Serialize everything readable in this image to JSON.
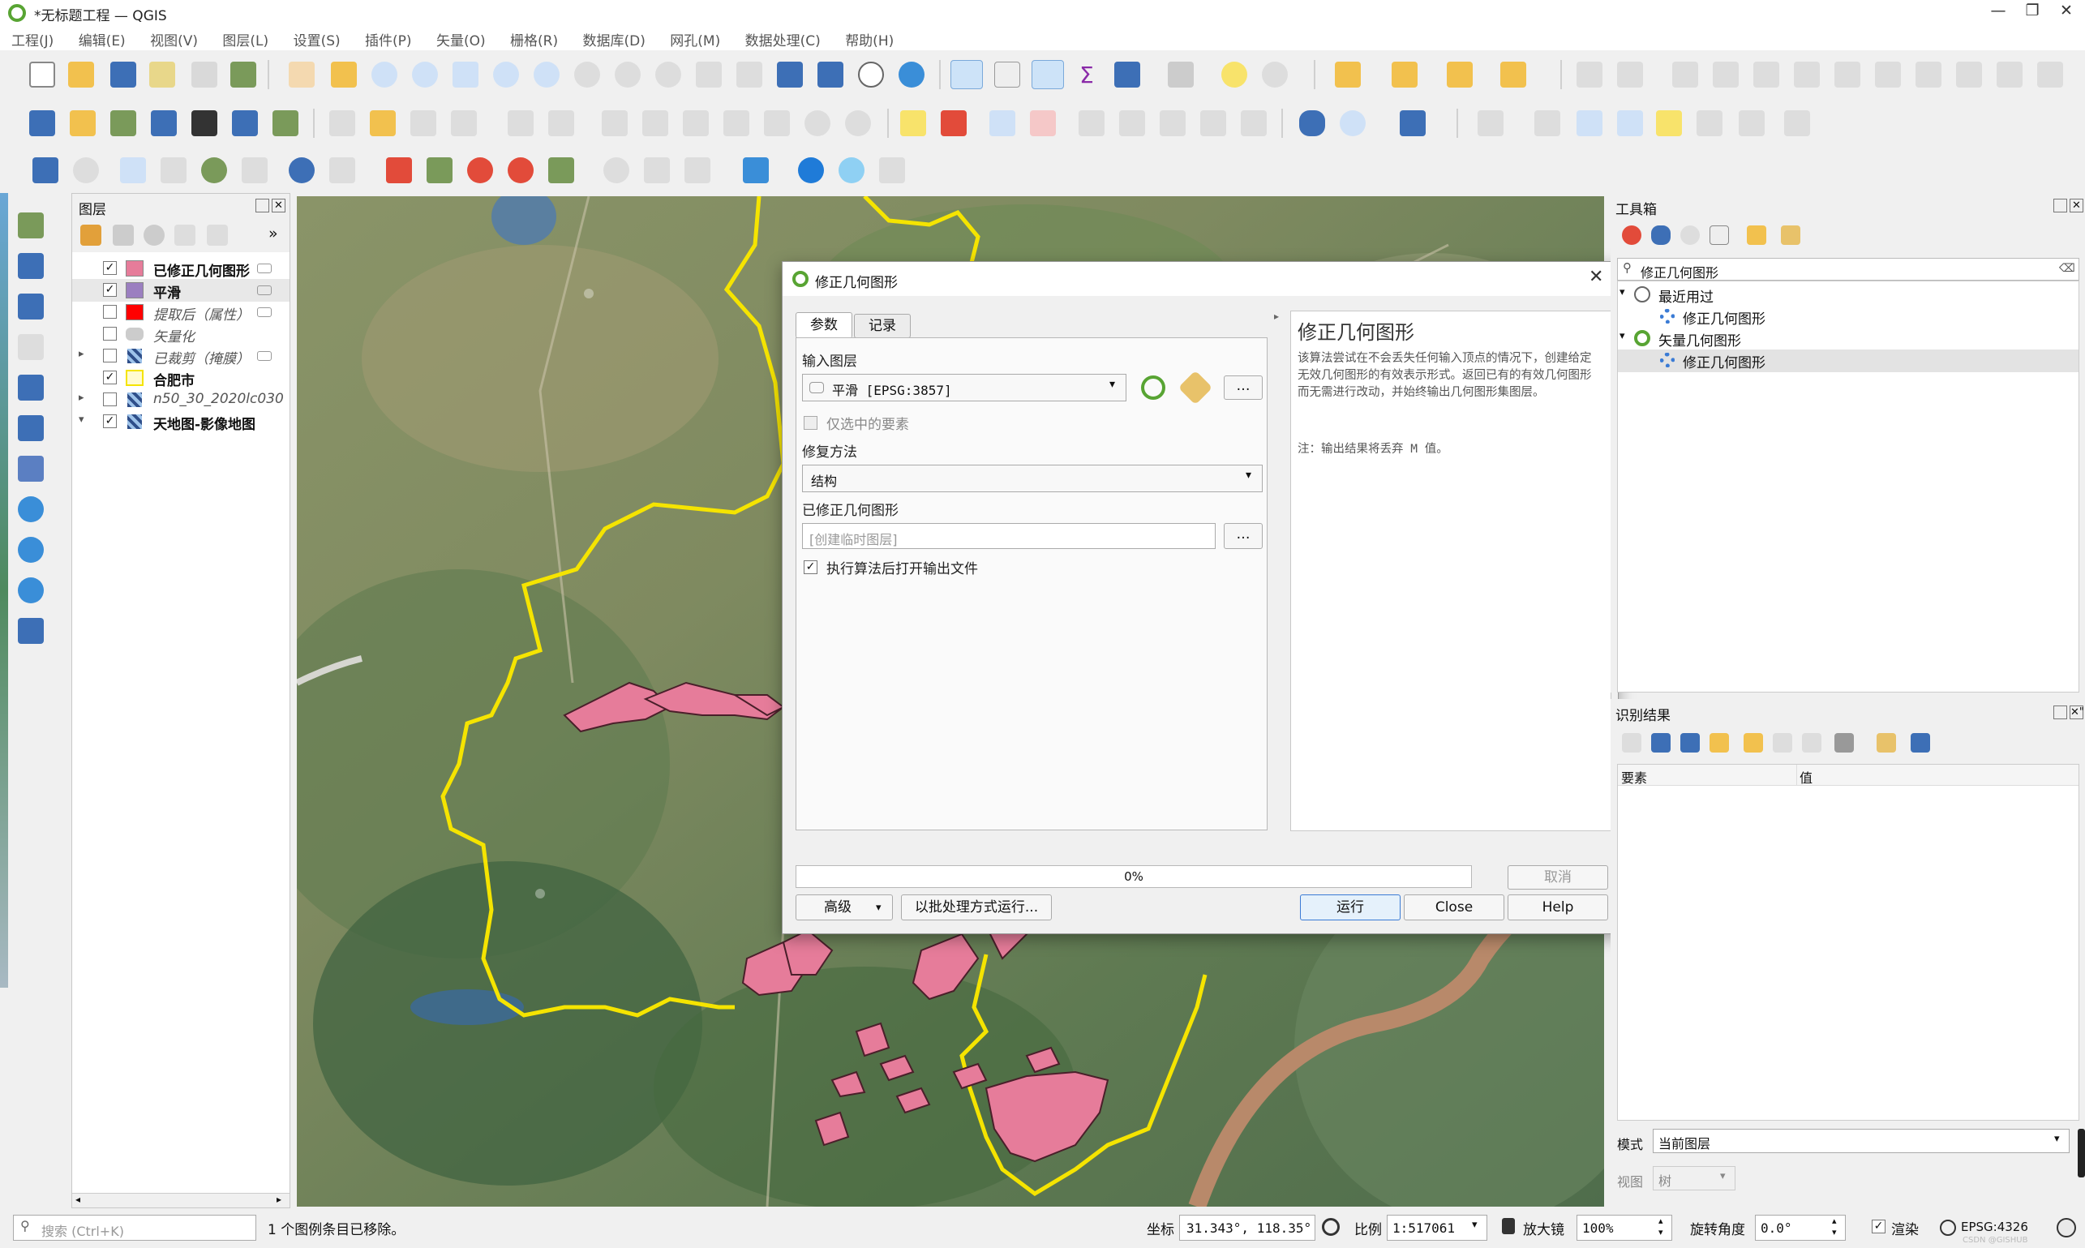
{
  "window": {
    "title": "*无标题工程 — QGIS",
    "minimize": "—",
    "maximize": "❐",
    "close": "✕"
  },
  "menu": [
    "工程(J)",
    "编辑(E)",
    "视图(V)",
    "图层(L)",
    "设置(S)",
    "插件(P)",
    "矢量(O)",
    "栅格(R)",
    "数据库(D)",
    "网孔(M)",
    "数据处理(C)",
    "帮助(H)"
  ],
  "layers_panel": {
    "title": "图层",
    "layers": [
      {
        "name": "已修正几何图形",
        "checked": true,
        "style": "bold",
        "swatch": "#e67c9a"
      },
      {
        "name": "平滑",
        "checked": true,
        "style": "bold",
        "swatch": "#9b7fc0"
      },
      {
        "name": "提取后（属性）",
        "checked": false,
        "style": "italic",
        "swatch": "#ff0000"
      },
      {
        "name": "矢量化",
        "checked": false,
        "style": "italic",
        "swatch": ""
      },
      {
        "name": "已裁剪（掩膜）",
        "checked": false,
        "style": "italic",
        "swatch": ""
      },
      {
        "name": "合肥市",
        "checked": true,
        "style": "bold",
        "swatch": "#fffbd0"
      },
      {
        "name": "n50_30_2020lc030",
        "checked": false,
        "style": "italic",
        "swatch": ""
      },
      {
        "name": "天地图-影像地图",
        "checked": true,
        "style": "bold",
        "swatch": ""
      }
    ]
  },
  "dialog": {
    "title": "修正几何图形",
    "tabs": [
      "参数",
      "记录"
    ],
    "input_layer_label": "输入图层",
    "input_layer_value": "平滑 [EPSG:3857]",
    "selected_only_label": "仅选中的要素",
    "method_label": "修复方法",
    "method_value": "结构",
    "output_label": "已修正几何图形",
    "output_placeholder": "[创建临时图层]",
    "open_output_label": "执行算法后打开输出文件",
    "help_title": "修正几何图形",
    "help_text": "该算法尝试在不会丢失任何输入顶点的情况下，创建给定无效几何图形的有效表示形式。返回已有的有效几何图形而无需进行改动，并始终输出几何图形集图层。",
    "help_note": "注：输出结果将丢弃 M 值。",
    "progress": "0%",
    "progress_value": 0,
    "cancel": "取消",
    "advanced": "高级",
    "batch": "以批处理方式运行...",
    "run": "运行",
    "close": "Close",
    "help": "Help",
    "ellipsis": "…"
  },
  "toolbox": {
    "title": "工具箱",
    "search_value": "修正几何图形",
    "tree": [
      {
        "label": "最近用过",
        "level": 0
      },
      {
        "label": "修正几何图形",
        "level": 1
      },
      {
        "label": "矢量几何图形",
        "level": 0
      },
      {
        "label": "修正几何图形",
        "level": 1
      }
    ]
  },
  "identify": {
    "title": "识别结果",
    "col_feature": "要素",
    "col_value": "值",
    "mode_label": "模式",
    "mode_value": "当前图层",
    "view_label": "视图",
    "view_value": "树"
  },
  "status": {
    "search_placeholder": "搜索 (Ctrl+K)",
    "message": "1 个图例条目已移除。",
    "coord_label": "坐标",
    "coord_value": "31.343°, 118.35°",
    "scale_label": "比例",
    "scale_value": "1:517061",
    "magnifier_label": "放大镜",
    "magnifier_value": "100%",
    "rotation_label": "旋转角度",
    "rotation_value": "0.0°",
    "render_label": "渲染",
    "crs": "EPSG:4326",
    "watermark": "CSDN @GISHUB"
  },
  "colors": {
    "accent": "#3a7bd5",
    "boundary": "#f5e400",
    "polygons": "#e67c9a"
  }
}
